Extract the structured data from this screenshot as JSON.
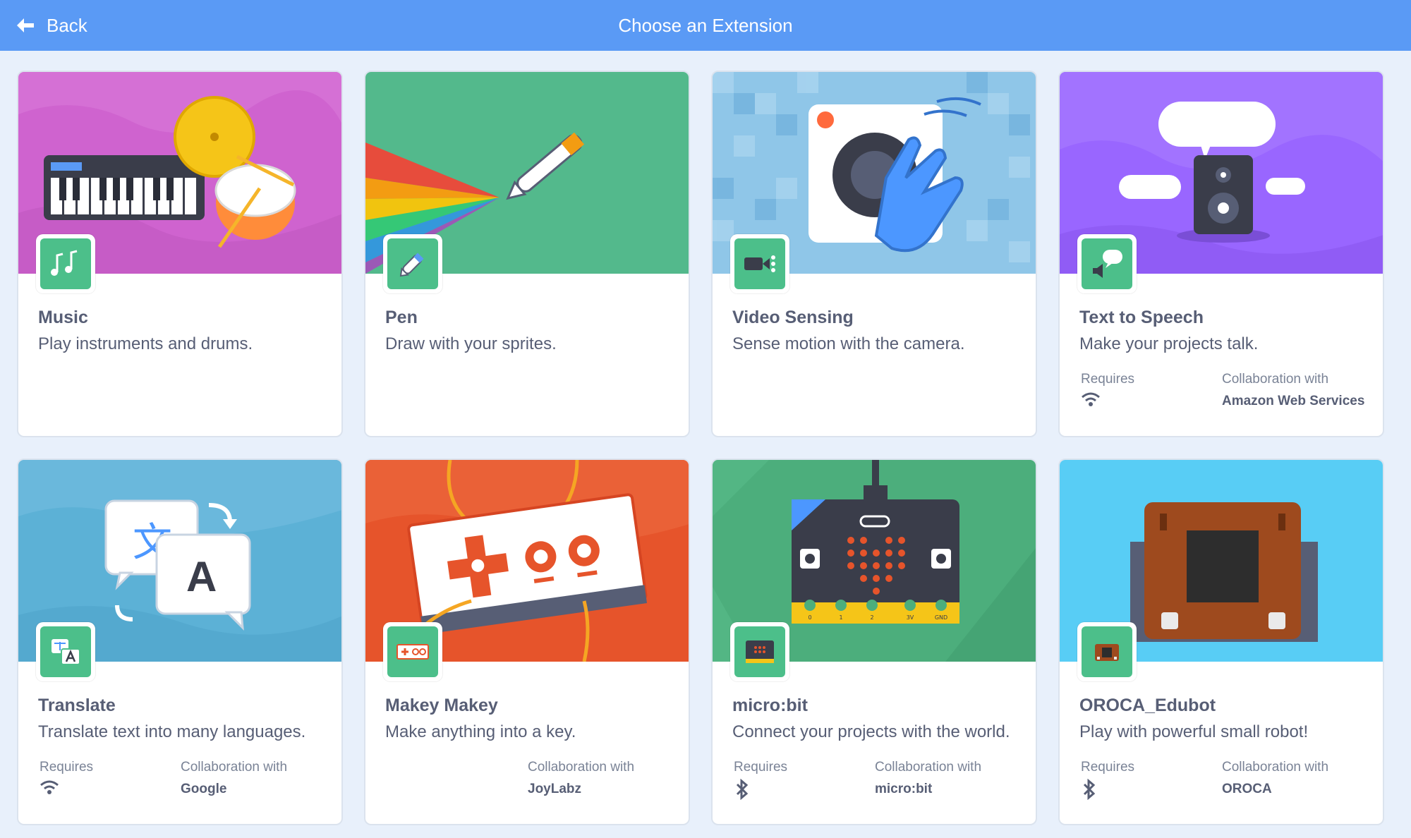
{
  "header": {
    "back_label": "Back",
    "title": "Choose an Extension"
  },
  "extensions": [
    {
      "name": "Music",
      "description": "Play instruments and drums."
    },
    {
      "name": "Pen",
      "description": "Draw with your sprites."
    },
    {
      "name": "Video Sensing",
      "description": "Sense motion with the camera."
    },
    {
      "name": "Text to Speech",
      "description": "Make your projects talk.",
      "requires_label": "Requires",
      "requires_icon": "wifi-icon",
      "collab_label": "Collaboration with",
      "collab_value": "Amazon Web Services"
    },
    {
      "name": "Translate",
      "description": "Translate text into many languages.",
      "requires_label": "Requires",
      "requires_icon": "wifi-icon",
      "collab_label": "Collaboration with",
      "collab_value": "Google"
    },
    {
      "name": "Makey Makey",
      "description": "Make anything into a key.",
      "collab_label": "Collaboration with",
      "collab_value": "JoyLabz"
    },
    {
      "name": "micro:bit",
      "description": "Connect your projects with the world.",
      "requires_label": "Requires",
      "requires_icon": "bluetooth-icon",
      "collab_label": "Collaboration with",
      "collab_value": "micro:bit"
    },
    {
      "name": "OROCA_Edubot",
      "description": "Play with powerful small robot!",
      "requires_label": "Requires",
      "requires_icon": "bluetooth-icon",
      "collab_label": "Collaboration with",
      "collab_value": "OROCA"
    }
  ],
  "banner_art": {
    "translate_glyph_cjk": "文",
    "translate_glyph_latin": "A",
    "microbit_pin_labels": [
      "0",
      "1",
      "2",
      "3V",
      "GND"
    ]
  },
  "colors": {
    "header": "#5a9af5",
    "icon_tile": "#4cbf8a",
    "text": "#575e75"
  }
}
